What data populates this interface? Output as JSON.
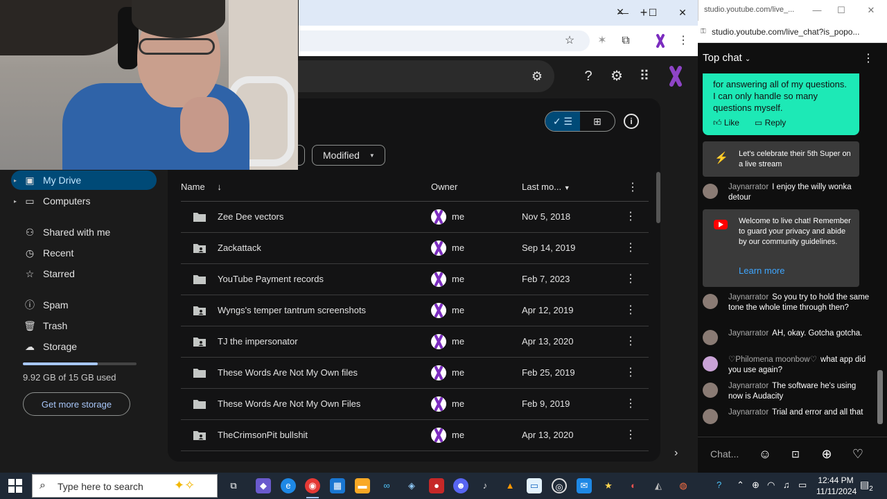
{
  "drive": {
    "nav": [
      {
        "label": "My Drive",
        "icon": "drive-icon",
        "active": true,
        "caret": true
      },
      {
        "label": "Computers",
        "icon": "computer-icon",
        "active": false,
        "caret": true
      },
      {
        "label": "Shared with me",
        "icon": "people-icon",
        "active": false,
        "caret": false
      },
      {
        "label": "Recent",
        "icon": "clock-icon",
        "active": false,
        "caret": false
      },
      {
        "label": "Starred",
        "icon": "star-icon",
        "active": false,
        "caret": false
      },
      {
        "label": "Spam",
        "icon": "spam-icon",
        "active": false,
        "caret": false
      },
      {
        "label": "Trash",
        "icon": "trash-icon",
        "active": false,
        "caret": false
      },
      {
        "label": "Storage",
        "icon": "cloud-icon",
        "active": false,
        "caret": false
      }
    ],
    "storage": {
      "used_text": "9.92 GB of 15 GB used",
      "used_fraction": 0.661,
      "button": "Get more storage"
    },
    "filter_chip": "Modified",
    "columns": {
      "name": "Name",
      "owner": "Owner",
      "modified": "Last mo..."
    },
    "files": [
      {
        "name": "Zee Dee vectors",
        "shared": false,
        "owner": "me",
        "date": "Nov 5, 2018"
      },
      {
        "name": "Zackattack",
        "shared": true,
        "owner": "me",
        "date": "Sep 14, 2019"
      },
      {
        "name": "YouTube Payment records",
        "shared": false,
        "owner": "me",
        "date": "Feb 7, 2023"
      },
      {
        "name": "Wyngs's temper tantrum screenshots",
        "shared": true,
        "owner": "me",
        "date": "Apr 12, 2019"
      },
      {
        "name": "TJ the impersonator",
        "shared": true,
        "owner": "me",
        "date": "Apr 13, 2020"
      },
      {
        "name": "These Words Are Not My Own files",
        "shared": false,
        "owner": "me",
        "date": "Feb 25, 2019"
      },
      {
        "name": "These Words Are Not My Own Files",
        "shared": false,
        "owner": "me",
        "date": "Feb 9, 2019"
      },
      {
        "name": "TheCrimsonPit bullshit",
        "shared": true,
        "owner": "me",
        "date": "Apr 13, 2020"
      }
    ],
    "accent": "#004a77"
  },
  "chat": {
    "window_title": "studio.youtube.com/live_...",
    "url": "studio.youtube.com/live_chat?is_popo...",
    "header": "Top chat",
    "super_text": "for answering all of my questions. I can only handle so many questions myself.",
    "like": "Like",
    "reply": "Reply",
    "celebrate": "Let's celebrate their 5th Super on a live stream",
    "welcome": "Welcome to live chat! Remember to guard your privacy and abide by our community guidelines.",
    "learn_more": "Learn more",
    "messages_a": [
      {
        "author": "Jaynarrator",
        "text": "I enjoy the willy wonka detour"
      }
    ],
    "messages_b": [
      {
        "author": "Jaynarrator",
        "text": "So you try to hold the same tone the whole time through then?"
      },
      {
        "author": "Jaynarrator",
        "text": "AH, okay. Gotcha gotcha."
      },
      {
        "author": "♡Philomena moonbow♡",
        "text": "what app did you use again?"
      },
      {
        "author": "Jaynarrator",
        "text": "The software he's using now is Audacity"
      },
      {
        "author": "Jaynarrator",
        "text": "Trial and error and all that"
      }
    ],
    "input_placeholder": "Chat...",
    "super_color": "#1de9b6"
  },
  "taskbar": {
    "search_placeholder": "Type here to search",
    "time": "12:44 PM",
    "date": "11/11/2024",
    "notifications": "2"
  }
}
